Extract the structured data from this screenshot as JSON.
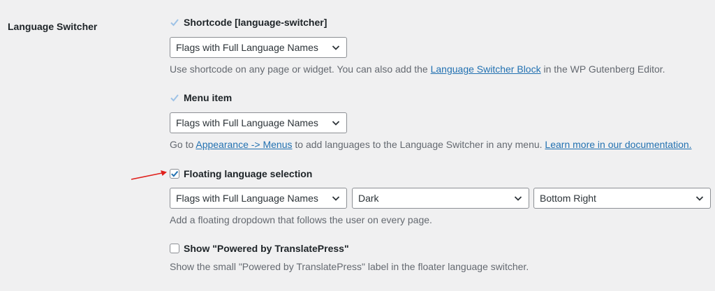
{
  "section": {
    "label": "Language Switcher"
  },
  "shortcode": {
    "title": "Shortcode [language-switcher]",
    "select_value": "Flags with Full Language Names",
    "desc_before": "Use shortcode on any page or widget. You can also add the ",
    "desc_link": "Language Switcher Block",
    "desc_after": " in the WP Gutenberg Editor."
  },
  "menu_item": {
    "title": "Menu item",
    "select_value": "Flags with Full Language Names",
    "desc_before": "Go to ",
    "desc_link1": "Appearance -> Menus",
    "desc_middle": " to add languages to the Language Switcher in any menu. ",
    "desc_link2": "Learn more in our documentation."
  },
  "floating": {
    "title": "Floating language selection",
    "checked": true,
    "select_style": "Flags with Full Language Names",
    "select_theme": "Dark",
    "select_position": "Bottom Right",
    "desc": "Add a floating dropdown that follows the user on every page."
  },
  "powered_by": {
    "title": "Show \"Powered by TranslatePress\"",
    "checked": false,
    "desc": "Show the small \"Powered by TranslatePress\" label in the floater language switcher."
  },
  "colors": {
    "background": "#f0f0f1",
    "link": "#2271b1",
    "check_disabled": "#9ec2e6",
    "check_active": "#2271b1",
    "arrow": "#e0201c"
  }
}
